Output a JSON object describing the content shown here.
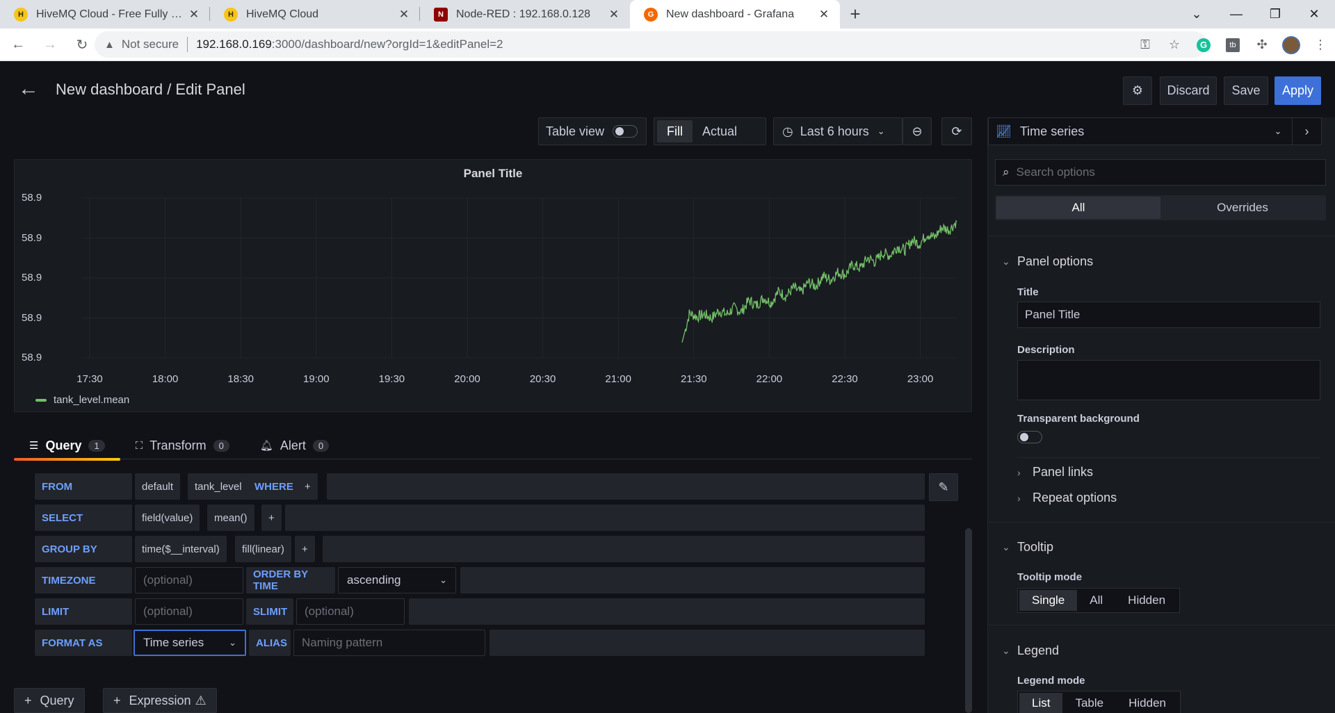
{
  "browser": {
    "tabs": [
      {
        "title": "HiveMQ Cloud - Free Fully Mana",
        "fav_color": "#f5c518",
        "fav_letter": "H"
      },
      {
        "title": "HiveMQ Cloud",
        "fav_color": "#f5c518",
        "fav_letter": "H"
      },
      {
        "title": "Node-RED : 192.168.0.128",
        "fav_color": "#8f0000",
        "fav_letter": "N"
      },
      {
        "title": "New dashboard - Grafana",
        "fav_color": "#f46800",
        "fav_letter": "G"
      }
    ],
    "not_secure": "Not secure",
    "url_host": "192.168.0.169",
    "url_path": ":3000/dashboard/new?orgId=1&editPanel=2"
  },
  "header": {
    "title": "New dashboard / Edit Panel",
    "discard": "Discard",
    "save": "Save",
    "apply": "Apply"
  },
  "toolbar": {
    "table_view": "Table view",
    "fill": "Fill",
    "actual": "Actual",
    "time_range": "Last 6 hours"
  },
  "panel": {
    "title": "Panel Title",
    "legend": "tank_level.mean",
    "series_color": "#73bf69"
  },
  "chart_data": {
    "type": "line",
    "title": "Panel Title",
    "y_ticks": [
      "58.9",
      "58.9",
      "58.9",
      "58.9",
      "58.9"
    ],
    "x_ticks": [
      "17:30",
      "18:00",
      "18:30",
      "19:00",
      "19:30",
      "20:00",
      "20:30",
      "21:00",
      "21:30",
      "22:00",
      "22:30",
      "23:00"
    ],
    "series": [
      {
        "name": "tank_level.mean",
        "values": [
          0.05,
          0.28,
          0.25,
          0.27,
          0.24,
          0.3,
          0.27,
          0.32,
          0.29,
          0.38,
          0.34,
          0.4,
          0.36,
          0.45,
          0.41,
          0.48,
          0.44,
          0.52,
          0.49,
          0.57,
          0.54,
          0.6,
          0.58,
          0.66,
          0.63,
          0.71,
          0.68,
          0.75,
          0.73,
          0.8,
          0.77,
          0.85,
          0.82,
          0.9,
          0.87,
          0.95,
          0.93,
          1.0
        ]
      }
    ],
    "x_start": "21:28",
    "x_end": "23:08",
    "grid": true,
    "legend_position": "bottom-left"
  },
  "query_tabs": [
    {
      "label": "Query",
      "count": "1"
    },
    {
      "label": "Transform",
      "count": "0"
    },
    {
      "label": "Alert",
      "count": "0"
    }
  ],
  "query": {
    "from_kw": "FROM",
    "from_db": "default",
    "from_meas": "tank_level",
    "where_kw": "WHERE",
    "select_kw": "SELECT",
    "select_field": "field(value)",
    "select_fn": "mean()",
    "groupby_kw": "GROUP BY",
    "groupby_time": "time($__interval)",
    "groupby_fill": "fill(linear)",
    "timezone_kw": "TIMEZONE",
    "optional": "(optional)",
    "orderby_kw": "ORDER BY TIME",
    "order_value": "ascending",
    "limit_kw": "LIMIT",
    "slimit_kw": "SLIMIT",
    "format_kw": "FORMAT AS",
    "format_value": "Time series",
    "alias_kw": "ALIAS",
    "alias_placeholder": "Naming pattern",
    "plus": "+"
  },
  "add": {
    "query": "Query",
    "expression": "Expression"
  },
  "options": {
    "viz": "Time series",
    "search_placeholder": "Search options",
    "all": "All",
    "overrides": "Overrides",
    "panel_options": "Panel options",
    "title_label": "Title",
    "title_value": "Panel Title",
    "description_label": "Description",
    "transparent_label": "Transparent background",
    "panel_links": "Panel links",
    "repeat_options": "Repeat options",
    "tooltip": "Tooltip",
    "tooltip_mode": "Tooltip mode",
    "tooltip_opts": [
      "Single",
      "All",
      "Hidden"
    ],
    "legend": "Legend",
    "legend_mode": "Legend mode",
    "legend_opts": [
      "List",
      "Table",
      "Hidden"
    ]
  }
}
